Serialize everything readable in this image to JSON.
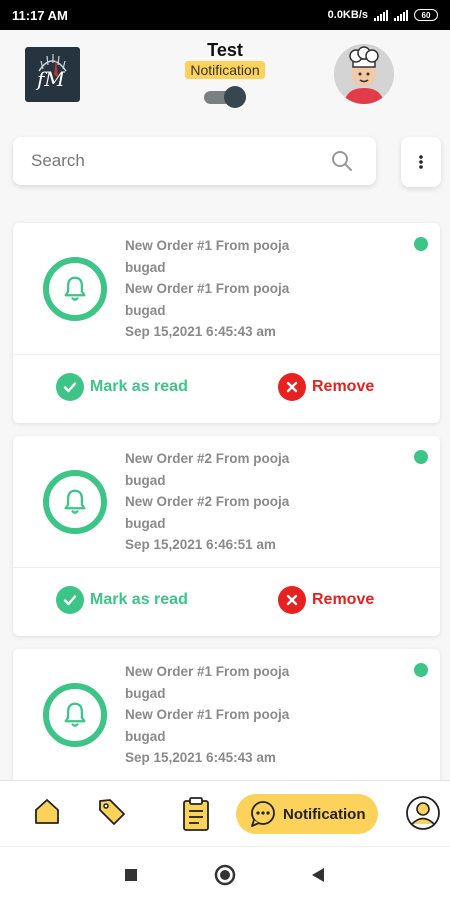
{
  "status_bar": {
    "time": "11:17 AM",
    "network_speed": "0.0KB/s",
    "battery": "60"
  },
  "header": {
    "title": "Test",
    "badge": "Notification",
    "toggle_on": true
  },
  "logo": {
    "text": "fM"
  },
  "search": {
    "placeholder": "Search",
    "value": ""
  },
  "notifications": [
    {
      "line1": "New Order #1 From pooja",
      "line2": "bugad",
      "line3": "New Order #1 From pooja",
      "line4": "bugad",
      "date": "Sep 15,2021 6:45:43 am",
      "unread": true
    },
    {
      "line1": "New Order #2 From pooja",
      "line2": "bugad",
      "line3": "New Order #2 From pooja",
      "line4": "bugad",
      "date": "Sep 15,2021 6:46:51 am",
      "unread": true
    },
    {
      "line1": "New Order #1 From pooja",
      "line2": "bugad",
      "line3": "New Order #1 From pooja",
      "line4": "bugad",
      "date": "Sep 15,2021 6:45:43 am",
      "unread": true
    }
  ],
  "actions": {
    "mark_read": "Mark as read",
    "remove": "Remove"
  },
  "bottom_nav": {
    "items": [
      {
        "icon": "home-icon"
      },
      {
        "icon": "tag-icon"
      },
      {
        "icon": "clipboard-icon"
      },
      {
        "icon": "chat-icon",
        "label": "Notification",
        "active": true
      },
      {
        "icon": "profile-icon"
      }
    ]
  },
  "colors": {
    "accent_green": "#3dc587",
    "remove_red": "#e8201f",
    "highlight_yellow": "#fcd25a"
  }
}
